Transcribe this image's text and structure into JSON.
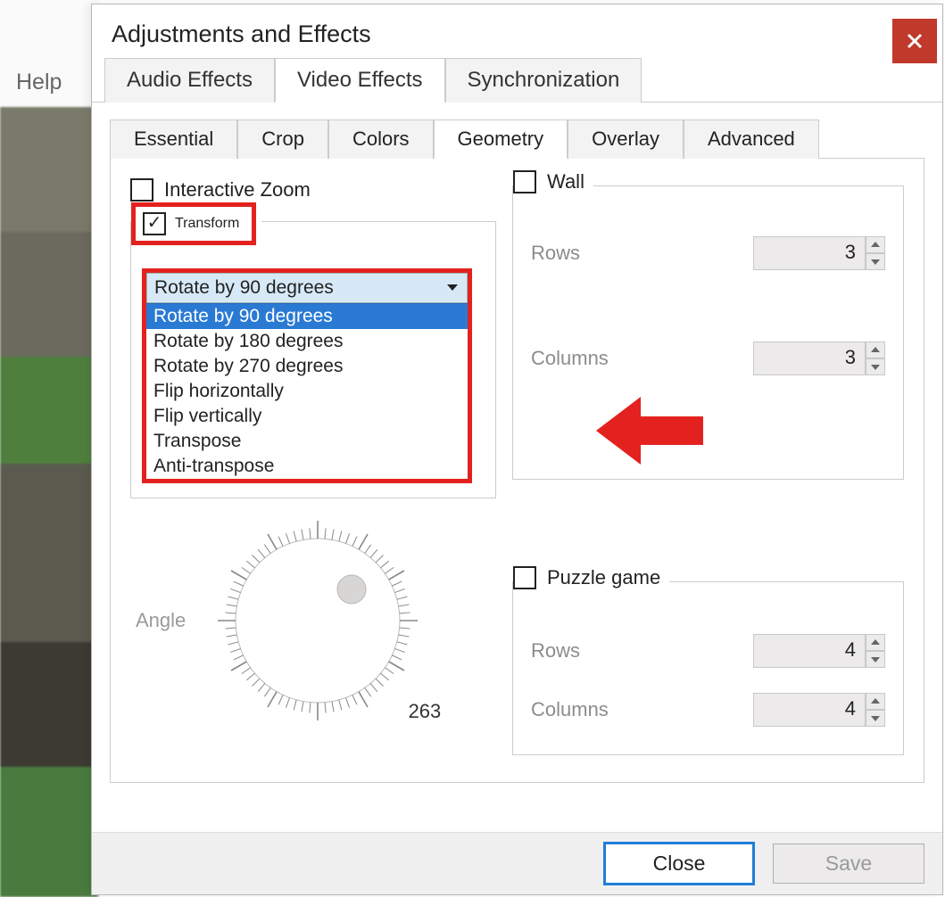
{
  "background_menu": {
    "help": "Help"
  },
  "dialog": {
    "title": "Adjustments and Effects",
    "main_tabs": {
      "audio": "Audio Effects",
      "video": "Video Effects",
      "sync": "Synchronization"
    },
    "sub_tabs": {
      "essential": "Essential",
      "crop": "Crop",
      "colors": "Colors",
      "geometry": "Geometry",
      "overlay": "Overlay",
      "advanced": "Advanced"
    },
    "interactive_zoom_label": "Interactive Zoom",
    "transform_label": "Transform",
    "transform_checked": true,
    "transform_dropdown": {
      "selected": "Rotate by 90 degrees",
      "options": [
        "Rotate by 90 degrees",
        "Rotate by 180 degrees",
        "Rotate by 270 degrees",
        "Flip horizontally",
        "Flip vertically",
        "Transpose",
        "Anti-transpose"
      ]
    },
    "angle": {
      "label": "Angle",
      "value": "263"
    },
    "wall": {
      "label": "Wall",
      "rows_label": "Rows",
      "rows_value": "3",
      "cols_label": "Columns",
      "cols_value": "3"
    },
    "puzzle": {
      "label": "Puzzle game",
      "rows_label": "Rows",
      "rows_value": "4",
      "cols_label": "Columns",
      "cols_value": "4"
    },
    "buttons": {
      "close": "Close",
      "save": "Save"
    }
  },
  "colors": {
    "red_highlight": "#e3221f",
    "accent_blue": "#1f7ed8"
  }
}
